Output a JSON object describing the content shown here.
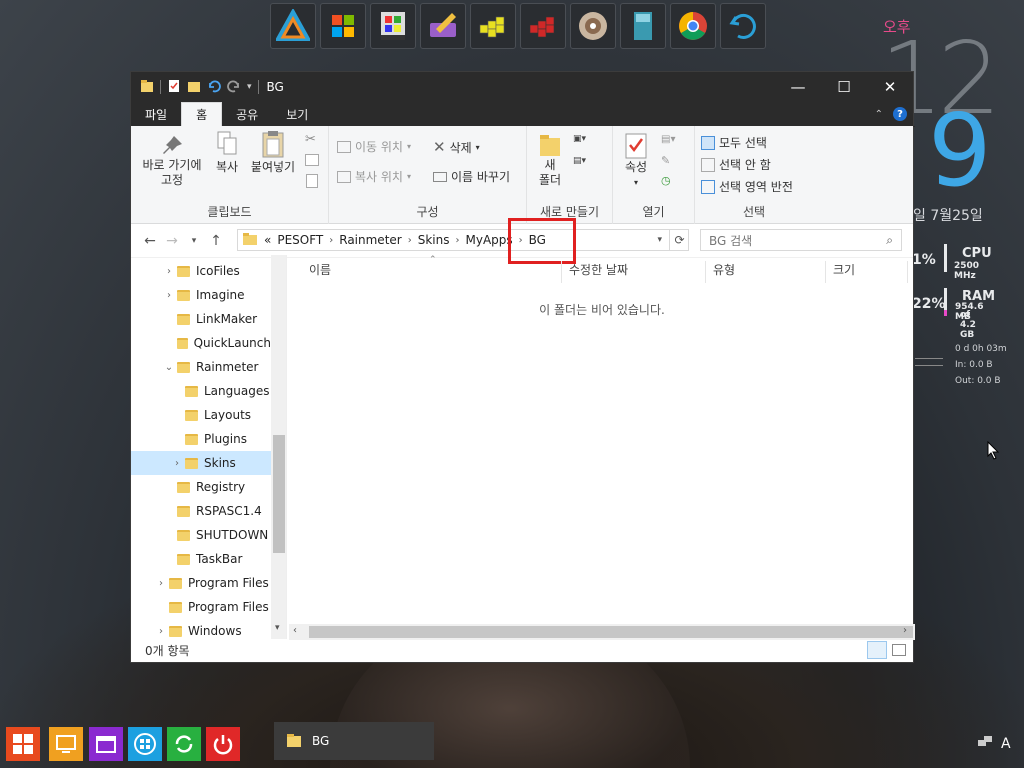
{
  "desktop": {
    "clock": {
      "ampm": "오후",
      "hour": "12",
      "minute": "9",
      "date": "일 7월25일"
    },
    "cpu": {
      "percent": "1%",
      "label": "CPU",
      "freq": "2500 MHz"
    },
    "ram": {
      "percent": "22%",
      "label": "RAM",
      "used": "954.6 MB",
      "total": "of  4.2 GB"
    },
    "net": {
      "uptime": "0 d 0h 03m",
      "in": "In: 0.0 B",
      "out": "Out: 0.0 B"
    }
  },
  "dock": [
    "aimp-icon",
    "windows-flag-icon",
    "winapp-icon",
    "disk-edit-icon",
    "registry-icon",
    "registry-red-icon",
    "disc-icon",
    "book-icon",
    "chrome-icon",
    "undo-icon"
  ],
  "window": {
    "title": "BG",
    "tabs": [
      {
        "label": "파일"
      },
      {
        "label": "홈"
      },
      {
        "label": "공유"
      },
      {
        "label": "보기"
      }
    ],
    "ribbon": {
      "clipboard": {
        "pin": "바로 가기에\n고정",
        "copy": "복사",
        "paste": "붙여넣기",
        "label": "클립보드"
      },
      "organize": {
        "move": "이동 위치",
        "copy": "복사 위치",
        "delete": "삭제",
        "rename": "이름 바꾸기",
        "label": "구성"
      },
      "new": {
        "folder": "새\n폴더",
        "label": "새로 만들기"
      },
      "open": {
        "props": "속성",
        "label": "열기"
      },
      "select": {
        "all": "모두 선택",
        "none": "선택 안 함",
        "invert": "선택 영역 반전",
        "label": "선택"
      }
    },
    "address": {
      "prefix": "«",
      "crumbs": [
        "PESOFT",
        "Rainmeter",
        "Skins",
        "MyApps",
        "BG"
      ]
    },
    "search_placeholder": "BG 검색",
    "tree": [
      {
        "label": "IcoFiles",
        "expand": true,
        "indent": 1
      },
      {
        "label": "Imagine",
        "expand": true,
        "indent": 1
      },
      {
        "label": "LinkMaker",
        "expand": false,
        "indent": 1
      },
      {
        "label": "QuickLaunch",
        "expand": false,
        "indent": 1
      },
      {
        "label": "Rainmeter",
        "expand": "open",
        "indent": 1
      },
      {
        "label": "Languages",
        "expand": false,
        "indent": 2
      },
      {
        "label": "Layouts",
        "expand": false,
        "indent": 2
      },
      {
        "label": "Plugins",
        "expand": false,
        "indent": 2
      },
      {
        "label": "Skins",
        "expand": true,
        "indent": 2,
        "selected": true
      },
      {
        "label": "Registry",
        "expand": false,
        "indent": 1
      },
      {
        "label": "RSPASC1.4",
        "expand": false,
        "indent": 1
      },
      {
        "label": "SHUTDOWN",
        "expand": false,
        "indent": 1
      },
      {
        "label": "TaskBar",
        "expand": false,
        "indent": 1
      },
      {
        "label": "Program Files",
        "expand": true,
        "indent": 0
      },
      {
        "label": "Program Files",
        "expand": false,
        "indent": 0
      },
      {
        "label": "Windows",
        "expand": true,
        "indent": 0
      }
    ],
    "columns": {
      "name": "이름",
      "date": "수정한 날짜",
      "type": "유형",
      "size": "크기"
    },
    "empty_message": "이 폴더는 비어 있습니다.",
    "status": "0개 항목"
  },
  "taskbar": {
    "app_label": "BG",
    "ime": "A"
  }
}
